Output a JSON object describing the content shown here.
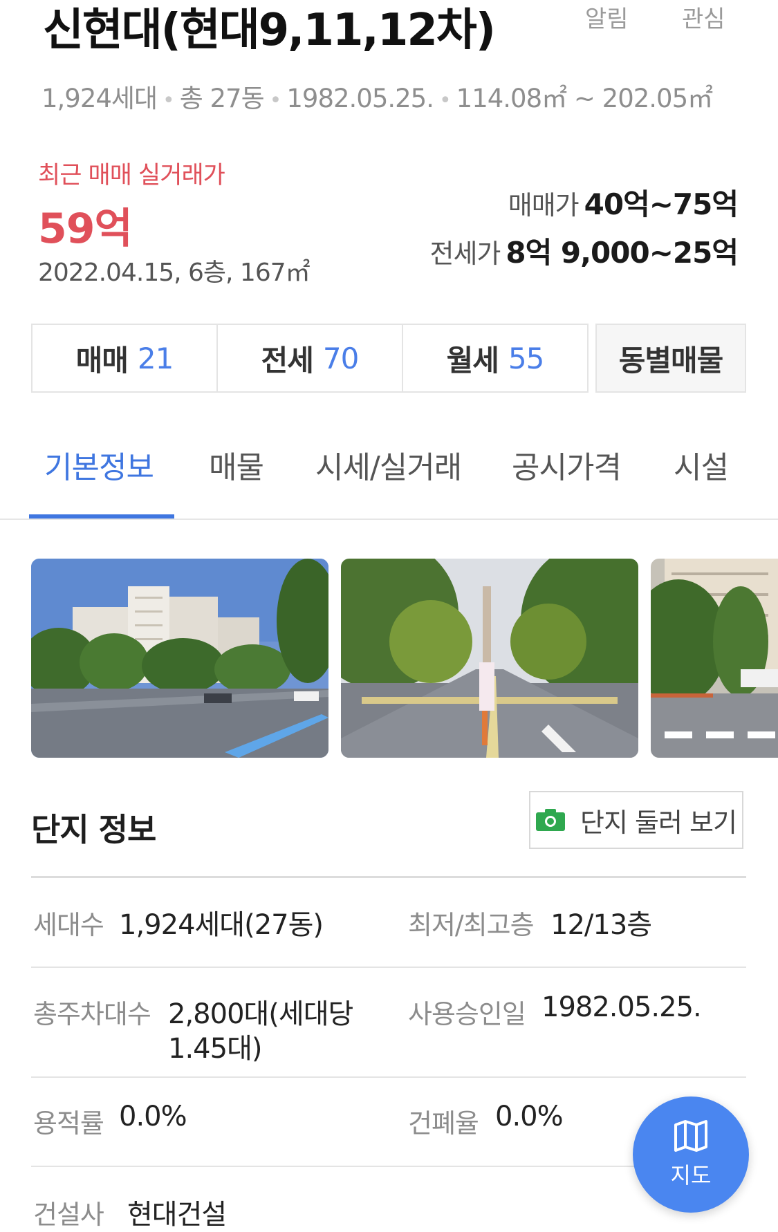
{
  "header": {
    "title": "신현대(현대9,11,12차)",
    "alert_label": "알림",
    "favorite_label": "관심",
    "summary": {
      "households": "1,924세대",
      "buildings": "총 27동",
      "approval_date": "1982.05.25.",
      "area_range": "114.08㎡ ~ 202.05㎡"
    }
  },
  "price": {
    "recent_label": "최근 매매 실거래가",
    "recent_value": "59억",
    "recent_detail": "2022.04.15, 6층, 167㎡",
    "sale_label": "매매가",
    "sale_range": "40억~75억",
    "jeonse_label": "전세가",
    "jeonse_range": "8억 9,000~25억"
  },
  "listings": {
    "sale": {
      "label": "매매",
      "count": "21"
    },
    "jeonse": {
      "label": "전세",
      "count": "70"
    },
    "monthly": {
      "label": "월세",
      "count": "55"
    },
    "by_building_label": "동별매물"
  },
  "tabs": [
    {
      "label": "기본정보",
      "active": true
    },
    {
      "label": "매물",
      "active": false
    },
    {
      "label": "시세/실거래",
      "active": false
    },
    {
      "label": "공시가격",
      "active": false
    },
    {
      "label": "시설",
      "active": false
    }
  ],
  "complex": {
    "section_title": "단지 정보",
    "tour_button": "단지 둘러 보기",
    "rows": [
      {
        "l1": "세대수",
        "v1": "1,924세대(27동)",
        "l2": "최저/최고층",
        "v2": "12/13층"
      },
      {
        "l1": "총주차대수",
        "v1a": "2,800대(세대당",
        "v1b": "1.45대)",
        "l2": "사용승인일",
        "v2": "1982.05.25."
      },
      {
        "l1": "용적률",
        "v1": "0.0%",
        "l2": "건폐율",
        "v2": "0.0%"
      },
      {
        "l1": "건설사",
        "v1": "현대건설"
      }
    ]
  },
  "map_button": {
    "label": "지도",
    "icon": "map-icon"
  },
  "colors": {
    "accent": "#3f76e0",
    "price_red": "#e0505a",
    "fab": "#4a86f0"
  }
}
